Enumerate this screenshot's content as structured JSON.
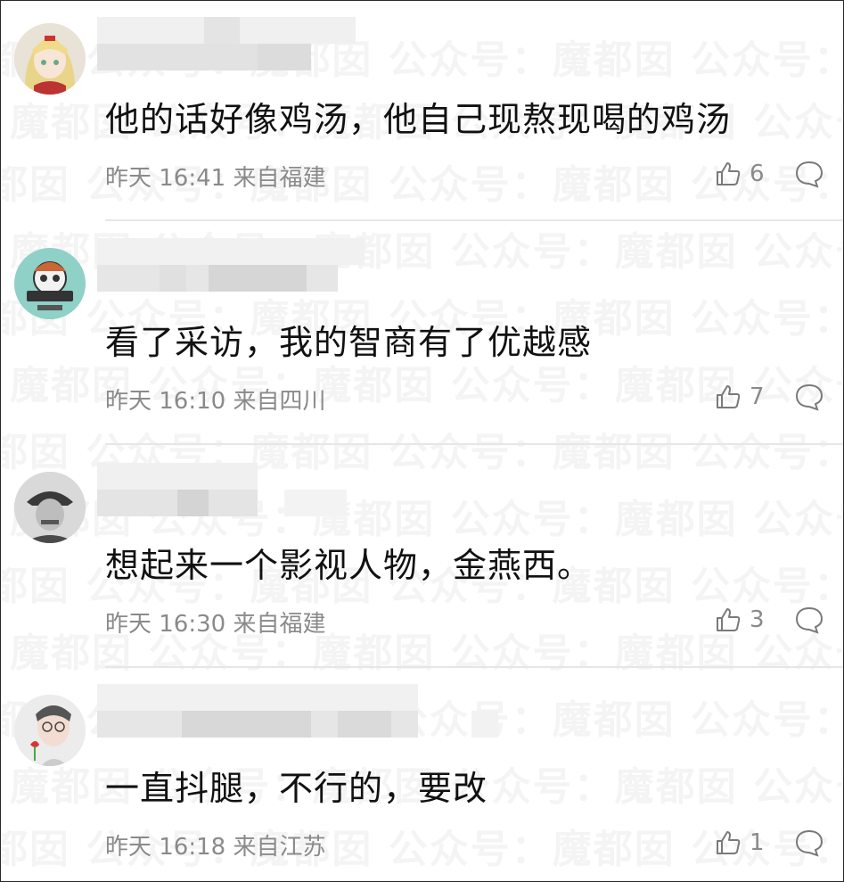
{
  "watermark": "魔都囡 公众号：魔都囡 公众号：魔都囡 公众号：魔都囡",
  "comments": [
    {
      "text": "他的话好像鸡汤，他自己现熬现喝的鸡汤",
      "time": "昨天 16:41 来自福建",
      "likes": "6"
    },
    {
      "text": "看了采访，我的智商有了优越感",
      "time": "昨天 16:10 来自四川",
      "likes": "7"
    },
    {
      "text": "想起来一个影视人物，金燕西。",
      "time": "昨天 16:30 来自福建",
      "likes": "3"
    },
    {
      "text": "一直抖腿，不行的，要改",
      "time": "昨天 16:18 来自江苏",
      "likes": "1"
    }
  ],
  "icons": {
    "like": "thumbs-up-icon",
    "reply": "comment-bubble-icon"
  },
  "colors": {
    "meta_text": "#8a8a8a",
    "body_text": "#111111",
    "divider": "#e6e6e6"
  }
}
